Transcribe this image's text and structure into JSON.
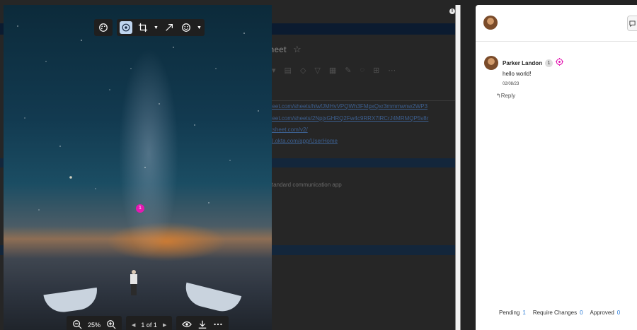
{
  "background_sheet": {
    "title": "heet",
    "links": [
      "heet.com/sheets/hlwfJMHvVPQWh3FMpxQxr3mmmwnw2WP3",
      "heet.com/sheets/2NpjxGHRQ2Fw4c9RRX7lRCrJ4MRMQP5v8r",
      "rtsheet.com/v2/",
      "al.okta.com/app/UserHome"
    ],
    "text_line": "standard communication app"
  },
  "viewer": {
    "pin_number": "1",
    "zoom_level": "25%",
    "page_indicator": "1 of 1",
    "icons": {
      "palette": "palette-icon",
      "target": "target-icon",
      "crop": "crop-icon",
      "arrow": "arrow-icon",
      "emoji": "emoji-icon",
      "zoom_out": "zoom-out-icon",
      "zoom_in": "zoom-in-icon",
      "eye": "eye-icon",
      "download": "download-icon",
      "more": "more-icon"
    }
  },
  "comments_panel": {
    "comments": [
      {
        "author": "Parker Landon",
        "number": "1",
        "body": "hello world!",
        "date": "02/08/23",
        "reply_label": "Reply"
      }
    ],
    "status": {
      "pending_label": "Pending",
      "pending_count": "1",
      "require_changes_label": "Require Changes",
      "require_changes_count": "0",
      "approved_label": "Approved",
      "approved_count": "0"
    }
  },
  "colors": {
    "annotation_pin": "#e419b2",
    "active_tool": "#bfd5ef",
    "count_blue": "#2a7bd6"
  }
}
